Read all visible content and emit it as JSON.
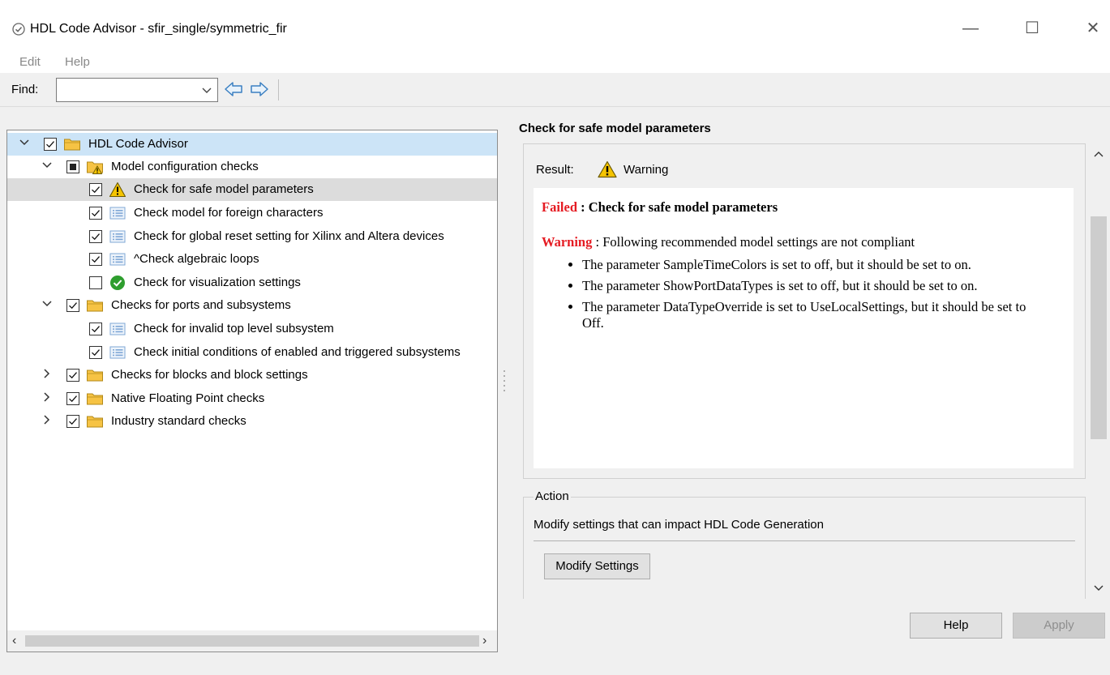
{
  "window": {
    "title": "HDL Code Advisor - sfir_single/symmetric_fir",
    "minimize": "—",
    "maximize": "☐",
    "close": "✕"
  },
  "menu": [
    "Edit",
    "Help"
  ],
  "toolbar": {
    "find_label": "Find:",
    "find_value": "",
    "dropdown_icon": "chevron-down-icon",
    "back_icon": "back-arrow-icon",
    "forward_icon": "forward-arrow-icon"
  },
  "tree": {
    "nodes": [
      {
        "label": "HDL Code Advisor",
        "state": "checked",
        "icon": "folder-icon",
        "expand": "expanded"
      },
      {
        "label": "Model configuration checks",
        "state": "partial",
        "icon": "folder-warning-icon",
        "expand": "expanded"
      },
      {
        "label": "Check for safe model parameters",
        "state": "checked",
        "icon": "warning-icon",
        "expand": "none"
      },
      {
        "label": "Check model for foreign characters",
        "state": "checked",
        "icon": "check-doc-icon",
        "expand": "none"
      },
      {
        "label": "Check for global reset setting for Xilinx and Altera devices",
        "state": "checked",
        "icon": "check-doc-icon",
        "expand": "none"
      },
      {
        "label": "^Check algebraic loops",
        "state": "checked",
        "icon": "check-doc-icon",
        "expand": "none"
      },
      {
        "label": "Check for visualization settings",
        "state": "unchecked",
        "icon": "pass-icon",
        "expand": "none"
      },
      {
        "label": "Checks for ports and subsystems",
        "state": "checked",
        "icon": "folder-icon",
        "expand": "expanded"
      },
      {
        "label": "Check for invalid top level subsystem",
        "state": "checked",
        "icon": "check-doc-icon",
        "expand": "none"
      },
      {
        "label": "Check initial conditions of enabled and triggered subsystems",
        "state": "checked",
        "icon": "check-doc-icon",
        "expand": "none"
      },
      {
        "label": "Checks for blocks and block settings",
        "state": "checked",
        "icon": "folder-icon",
        "expand": "collapsed"
      },
      {
        "label": "Native Floating Point checks",
        "state": "checked",
        "icon": "folder-icon",
        "expand": "collapsed"
      },
      {
        "label": "Industry standard checks",
        "state": "checked",
        "icon": "folder-icon",
        "expand": "collapsed"
      }
    ]
  },
  "detail": {
    "title": "Check for safe model parameters",
    "result_label": "Result:",
    "result_value": "Warning",
    "failed_word": "Failed",
    "failed_text": " : Check for safe model parameters",
    "warning_word": "Warning",
    "warning_text": " : Following recommended model settings are not compliant",
    "bullets": [
      "The parameter SampleTimeColors is set to off, but it should be set to on.",
      "The parameter ShowPortDataTypes is set to off, but it should be set to on.",
      "The parameter DataTypeOverride is set to UseLocalSettings, but it should be set to Off."
    ]
  },
  "action": {
    "legend": "Action",
    "description": "Modify settings that can impact HDL Code Generation",
    "button": "Modify Settings"
  },
  "footer": {
    "help": "Help",
    "apply": "Apply"
  },
  "colors": {
    "accent_red": "#e51c23",
    "selection_blue": "#cce4f7",
    "warning_yellow": "#f5c400",
    "pass_green": "#2e9e2e",
    "folder_yellow": "#f6c344"
  }
}
